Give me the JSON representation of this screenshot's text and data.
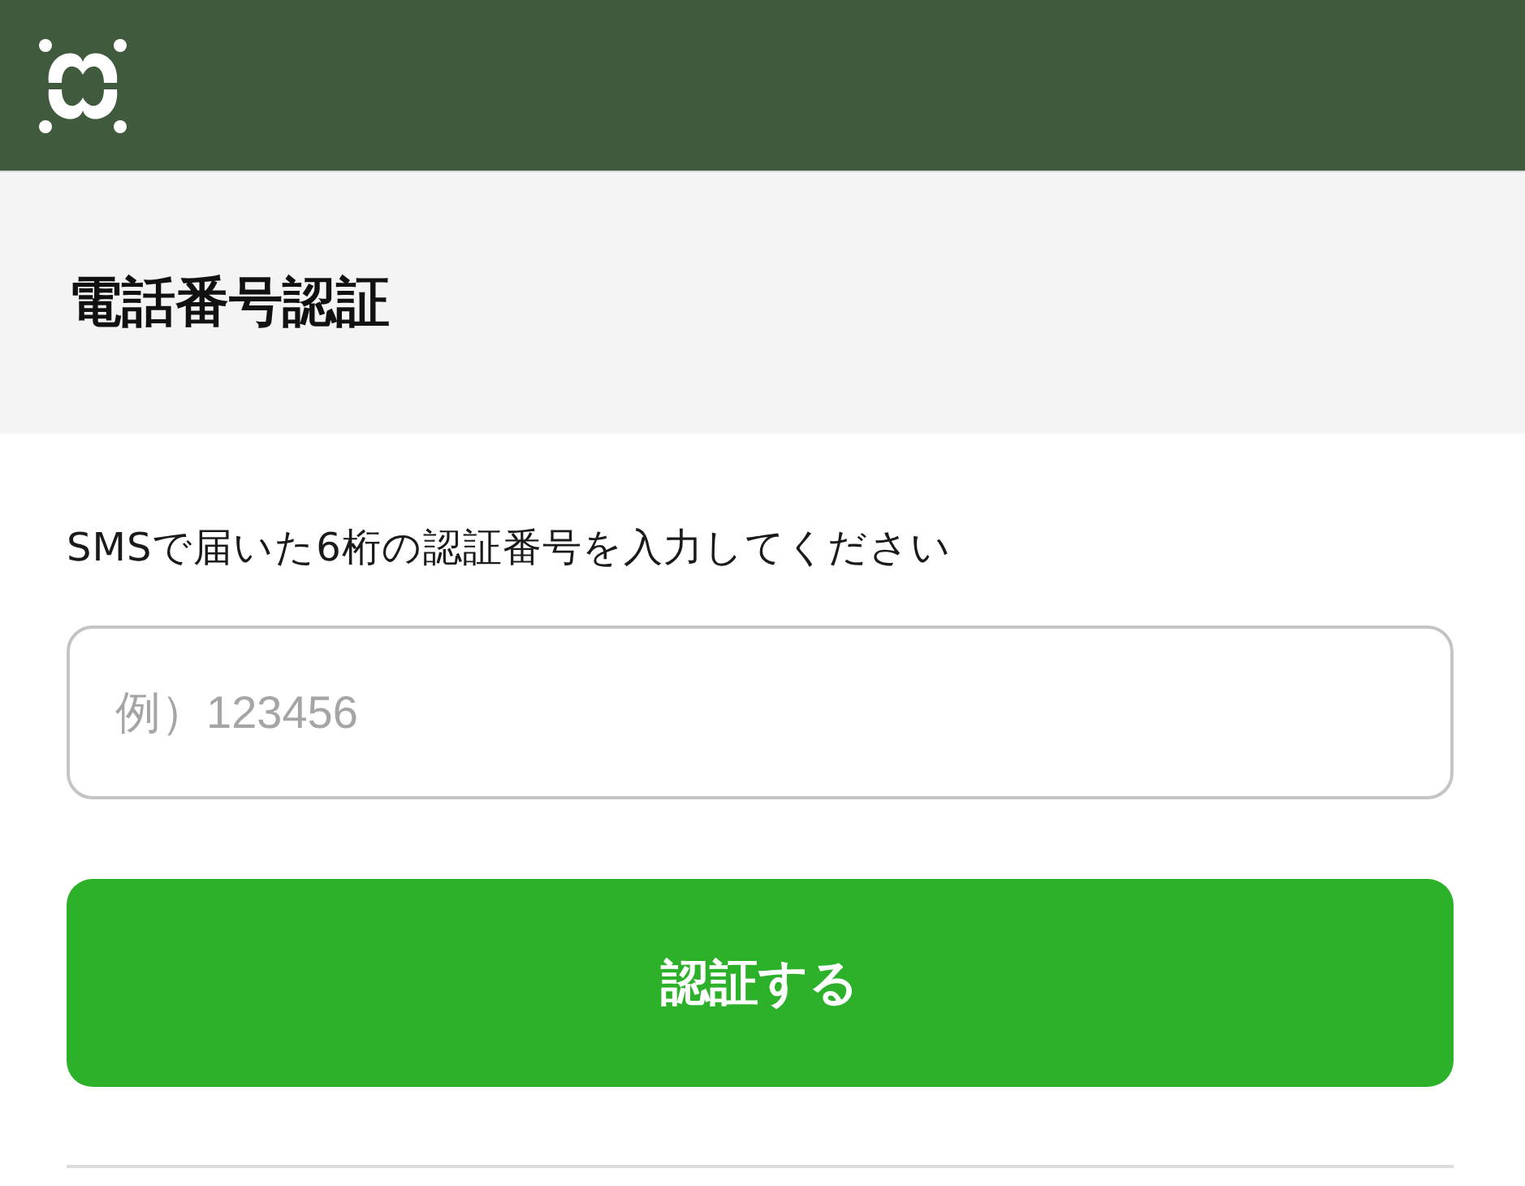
{
  "page_title": "電話番号認証",
  "instruction": "SMSで届いた6桁の認証番号を入力してください",
  "code_field": {
    "placeholder": "例）123456"
  },
  "submit_button": {
    "label": "認証する"
  }
}
